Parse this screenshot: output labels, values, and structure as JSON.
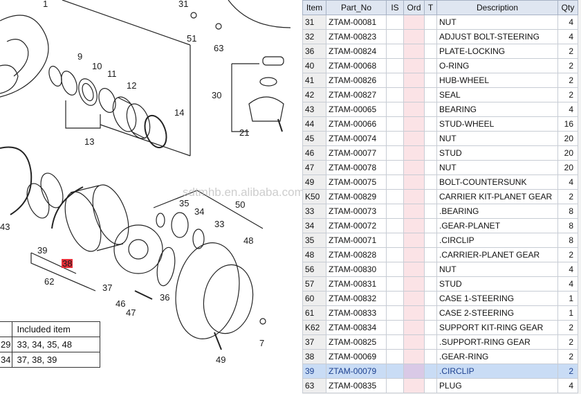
{
  "diagram": {
    "callouts": {
      "c1": "1",
      "c31": "31",
      "c51": "51",
      "c63": "63",
      "c9": "9",
      "c10": "10",
      "c11": "11",
      "c12": "12",
      "c14": "14",
      "c13": "13",
      "c30": "30",
      "c21": "21",
      "c43": "43",
      "c39": "39",
      "c38": "38",
      "c62": "62",
      "c37": "37",
      "c35": "35",
      "c34": "34",
      "c50": "50",
      "c33": "33",
      "c48": "48",
      "c46": "46",
      "c47": "47",
      "c36": "36",
      "c7": "7",
      "c49": "49"
    },
    "watermark": "sdtmhb.en.alibaba.com"
  },
  "included_table": {
    "header": "Included item",
    "rows": [
      {
        "left": "29",
        "items": "33, 34, 35, 48"
      },
      {
        "left": "34",
        "items": "37, 38, 39"
      }
    ]
  },
  "parts": {
    "columns": [
      "Item",
      "Part_No",
      "IS",
      "Ord",
      "T",
      "Description",
      "Qty"
    ],
    "selected_index": 24,
    "rows": [
      {
        "item": "31",
        "part_no": "ZTAM-00081",
        "desc": "NUT",
        "qty": "4"
      },
      {
        "item": "32",
        "part_no": "ZTAM-00823",
        "desc": "ADJUST BOLT-STEERING",
        "qty": "4"
      },
      {
        "item": "36",
        "part_no": "ZTAM-00824",
        "desc": "PLATE-LOCKING",
        "qty": "2"
      },
      {
        "item": "40",
        "part_no": "ZTAM-00068",
        "desc": "O-RING",
        "qty": "2"
      },
      {
        "item": "41",
        "part_no": "ZTAM-00826",
        "desc": "HUB-WHEEL",
        "qty": "2"
      },
      {
        "item": "42",
        "part_no": "ZTAM-00827",
        "desc": "SEAL",
        "qty": "2"
      },
      {
        "item": "43",
        "part_no": "ZTAM-00065",
        "desc": "BEARING",
        "qty": "4"
      },
      {
        "item": "44",
        "part_no": "ZTAM-00066",
        "desc": "STUD-WHEEL",
        "qty": "16"
      },
      {
        "item": "45",
        "part_no": "ZTAM-00074",
        "desc": "NUT",
        "qty": "20"
      },
      {
        "item": "46",
        "part_no": "ZTAM-00077",
        "desc": "STUD",
        "qty": "20"
      },
      {
        "item": "47",
        "part_no": "ZTAM-00078",
        "desc": "NUT",
        "qty": "20"
      },
      {
        "item": "49",
        "part_no": "ZTAM-00075",
        "desc": "BOLT-COUNTERSUNK",
        "qty": "4"
      },
      {
        "item": "K50",
        "part_no": "ZTAM-00829",
        "desc": "CARRIER KIT-PLANET GEAR",
        "qty": "2"
      },
      {
        "item": "33",
        "part_no": "ZTAM-00073",
        "desc": ".BEARING",
        "qty": "8"
      },
      {
        "item": "34",
        "part_no": "ZTAM-00072",
        "desc": ".GEAR-PLANET",
        "qty": "8"
      },
      {
        "item": "35",
        "part_no": "ZTAM-00071",
        "desc": ".CIRCLIP",
        "qty": "8"
      },
      {
        "item": "48",
        "part_no": "ZTAM-00828",
        "desc": ".CARRIER-PLANET GEAR",
        "qty": "2"
      },
      {
        "item": "56",
        "part_no": "ZTAM-00830",
        "desc": "NUT",
        "qty": "4"
      },
      {
        "item": "57",
        "part_no": "ZTAM-00831",
        "desc": "STUD",
        "qty": "4"
      },
      {
        "item": "60",
        "part_no": "ZTAM-00832",
        "desc": "CASE 1-STEERING",
        "qty": "1"
      },
      {
        "item": "61",
        "part_no": "ZTAM-00833",
        "desc": "CASE 2-STEERING",
        "qty": "1"
      },
      {
        "item": "K62",
        "part_no": "ZTAM-00834",
        "desc": "SUPPORT KIT-RING GEAR",
        "qty": "2"
      },
      {
        "item": "37",
        "part_no": "ZTAM-00825",
        "desc": ".SUPPORT-RING GEAR",
        "qty": "2"
      },
      {
        "item": "38",
        "part_no": "ZTAM-00069",
        "desc": ".GEAR-RING",
        "qty": "2"
      },
      {
        "item": "39",
        "part_no": "ZTAM-00079",
        "desc": ".CIRCLIP",
        "qty": "2"
      },
      {
        "item": "63",
        "part_no": "ZTAM-00835",
        "desc": "PLUG",
        "qty": "4"
      }
    ]
  },
  "colors": {
    "selected_row": "#c9dcf5",
    "ord_column": "#fbe3e6",
    "header_bg": "#dfe6f1",
    "callout_highlight": "#e8303a"
  }
}
